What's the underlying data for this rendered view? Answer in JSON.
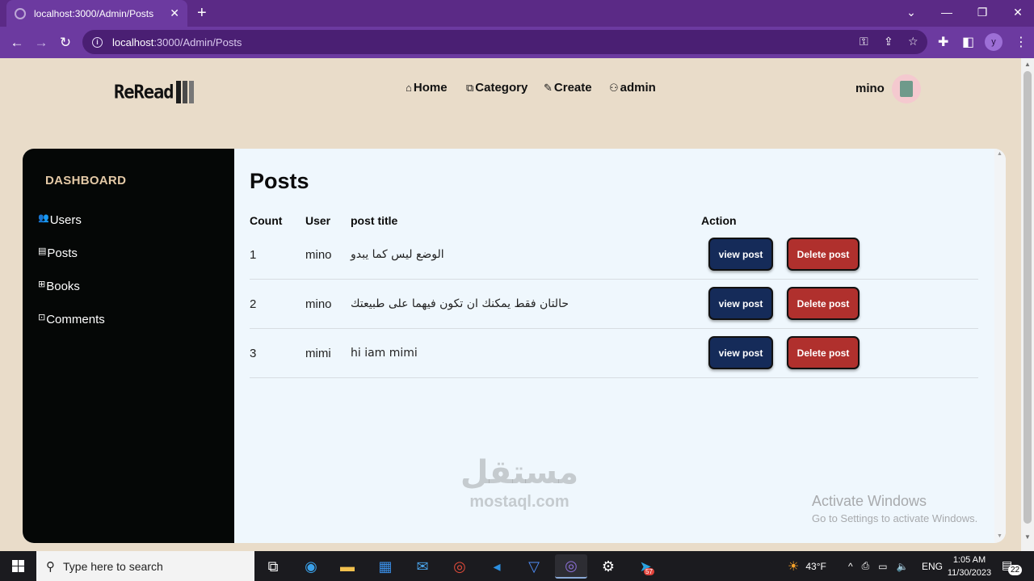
{
  "browser": {
    "tab_title": "localhost:3000/Admin/Posts",
    "close_glyph": "✕",
    "new_tab_glyph": "+",
    "url_host": "localhost",
    "url_rest": ":3000/Admin/Posts",
    "profile_letter": "y",
    "window_minimize": "—",
    "window_restore": "❐",
    "window_close": "✕",
    "chevron": "⌄"
  },
  "site": {
    "logo_text": "ReRead",
    "logo_bar_colors": [
      "#1d1d1d",
      "#4a4a4a",
      "#777777"
    ],
    "nav": [
      {
        "icon": "home-icon",
        "glyph": "⌂",
        "label": "Home"
      },
      {
        "icon": "copy-icon",
        "glyph": "⧉",
        "label": "Category"
      },
      {
        "icon": "edit-icon",
        "glyph": "✎",
        "label": "Create"
      },
      {
        "icon": "user-icon",
        "glyph": "⚇",
        "label": "admin"
      }
    ],
    "user_name": "mino"
  },
  "sidebar": {
    "heading": "DASHBOARD",
    "items": [
      {
        "icon": "users-icon",
        "glyph": "👥",
        "label": "Users"
      },
      {
        "icon": "posts-icon",
        "glyph": "▤",
        "label": "Posts"
      },
      {
        "icon": "books-icon",
        "glyph": "⊞",
        "label": "Books"
      },
      {
        "icon": "comments-icon",
        "glyph": "⊡",
        "label": "Comments"
      }
    ]
  },
  "posts_table": {
    "title": "Posts",
    "columns": {
      "count": "Count",
      "user": "User",
      "post_title": "post title",
      "action": "Action"
    },
    "rows": [
      {
        "count": "1",
        "user": "mino",
        "title": "الوضع ليس كما يبدو",
        "view_label": "view post",
        "delete_label": "Delete post"
      },
      {
        "count": "2",
        "user": "mino",
        "title": "حالتان فقط يمكنك ان تكون فيهما على طبيعتك",
        "view_label": "view post",
        "delete_label": "Delete post"
      },
      {
        "count": "3",
        "user": "mimi",
        "title": "hi iam mimi",
        "view_label": "view post",
        "delete_label": "Delete post"
      }
    ]
  },
  "overlay": {
    "activate_line1": "Activate Windows",
    "activate_line2": "Go to Settings to activate Windows.",
    "mostaql_ar": "مستقل",
    "mostaql_lat": "mostaql.com"
  },
  "taskbar": {
    "search_placeholder": "Type here to search",
    "weather": "43°F",
    "language": "ENG",
    "time": "1:05 AM",
    "date": "11/30/2023",
    "notification_count": "22",
    "telegram_badge": "57"
  },
  "colors": {
    "page_bg": "#e9dcc9",
    "sidebar_bg": "#050706",
    "sidebar_heading": "#e4c9a6",
    "content_bg": "#eff7fd",
    "view_button": "#152b59",
    "delete_button": "#b0302d",
    "browser_purple": "#6c3aa0"
  }
}
